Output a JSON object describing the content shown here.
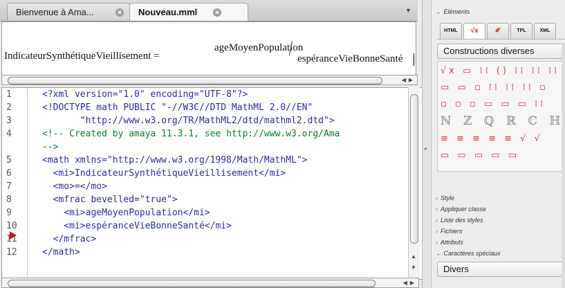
{
  "tabs": [
    {
      "label": "Bienvenue à Ama...",
      "active": false
    },
    {
      "label": "Nouveau.mml",
      "active": true
    }
  ],
  "formula": {
    "lhs": "IndicateurSynthétiqueVieillisement",
    "op": "=",
    "numerator": "ageMoyenPopulation",
    "denominator": "espéranceVieBonneSanté"
  },
  "source": {
    "line_numbers": [
      "1",
      "2",
      "3",
      "4",
      "",
      "5",
      "6",
      "7",
      "8",
      "9",
      "10",
      "11",
      "12"
    ],
    "lines": [
      "<?xml version=\"1.0\" encoding=\"UTF-8\"?>",
      "<!DOCTYPE math PUBLIC \"-//W3C//DTD MathML 2.0//EN\"",
      "       \"http://www.w3.org/TR/MathML2/dtd/mathml2.dtd\">",
      "<!-- Created by amaya 11.3.1, see http://www.w3.org/Ama",
      "-->",
      "<math xmlns=\"http://www.w3.org/1998/Math/MathML\">",
      "  <mi>IndicateurSynthétiqueVieillisement</mi>",
      "  <mo>=</mo>",
      "  <mfrac bevelled=\"true\">",
      "    <mi>ageMoyenPopulation</mi>",
      "    <mi>espéranceVieBonneSanté</mi>",
      "  </mfrac>",
      "</math>"
    ],
    "line_kinds": [
      "tag",
      "tag",
      "tag",
      "comment",
      "comment",
      "tag",
      "tag",
      "tag",
      "tag",
      "tag",
      "tag",
      "tag",
      "tag"
    ],
    "current_line": 10
  },
  "panel": {
    "elements_title": "Eléments",
    "element_tabs": [
      "HTML",
      "√x",
      "✐",
      "TPL",
      "XML"
    ],
    "construct_select": "Constructions diverses",
    "palette_rows": [
      "√x ▭ ⁞⁞ () ⁞⁞ ⁞⁞ ⁞⁞",
      "▭ ▭ ▫ ⁞⁞ ⁞⁞ ⁞⁞ ▫",
      "▫ ▫ ▫ ▭ ▭ ▭ ⁞⁞",
      "ℕ ℤ ℚ ℝ ℂ ℍ ℙ",
      "≡ ≡ ≡ ≡ ≡ √ √",
      "▭ ▭ ▭ ▭ ▭"
    ],
    "sections": [
      "Style",
      "Appliquer classe",
      "Liste des styles",
      "Fichiers",
      "Attributs",
      "Caractères spéciaux"
    ],
    "divers_select": "Divers"
  },
  "colors": {
    "tag": "#2a2aa8",
    "comment": "#0d7a2a",
    "palette": "#d43a3a",
    "marker": "#d01010"
  }
}
